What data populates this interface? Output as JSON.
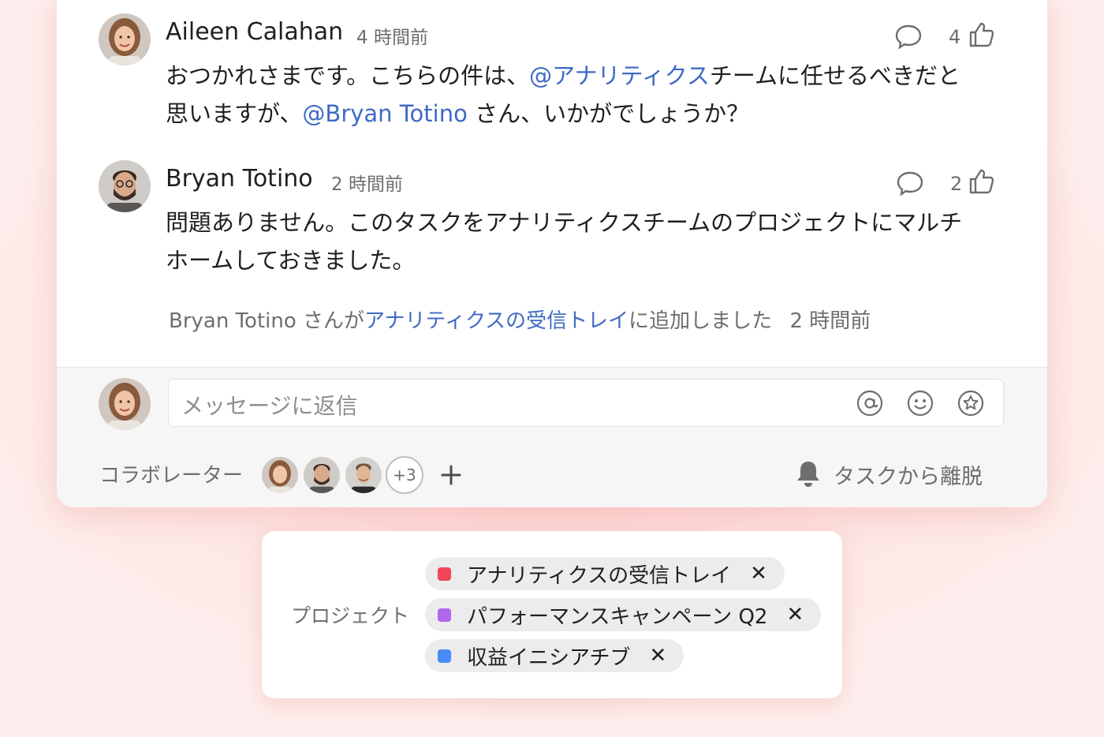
{
  "thread": {
    "comments": [
      {
        "author": "Aileen Calahan",
        "time": "4 時間前",
        "text_before": "おつかれさまです。こちらの件は、",
        "mention_team": "@アナリティクス",
        "text_mid": "チームに任せるべきだと",
        "text_line2_before": "思いますが、",
        "mention_user": "@Bryan Totino",
        "text_after": " さん、いかがでしょうか？",
        "like_count": "4"
      },
      {
        "author": "Bryan Totino",
        "time": "2 時間前",
        "line1": "問題ありません。このタスクをアナリティクスチームのプロジェクトにマルチ",
        "line2": "ホームしておきました。",
        "like_count": "2"
      }
    ],
    "activity": {
      "actor": "Bryan Totino さんが",
      "link": "アナリティクスの受信トレイ",
      "action": "に追加しました",
      "time": "2 時間前"
    }
  },
  "reply": {
    "placeholder": "メッセージに返信",
    "icons": [
      "at-icon",
      "emoji-icon",
      "star-icon"
    ]
  },
  "collaborators": {
    "label": "コラボレーター",
    "more": "+3",
    "leave_label": "タスクから離脱"
  },
  "projects": {
    "label": "プロジェクト",
    "items": [
      {
        "name": "アナリティクスの受信トレイ",
        "color": "#f0455a"
      },
      {
        "name": "パフォーマンスキャンペーン Q2",
        "color": "#b067e9"
      },
      {
        "name": "収益イニシアチブ",
        "color": "#4a8cf7"
      }
    ],
    "remove_glyph": "✕"
  },
  "colors": {
    "link": "#3f6ac4",
    "text": "#1e1f21",
    "muted": "#6d6e6f",
    "background": "#fdeeed"
  }
}
